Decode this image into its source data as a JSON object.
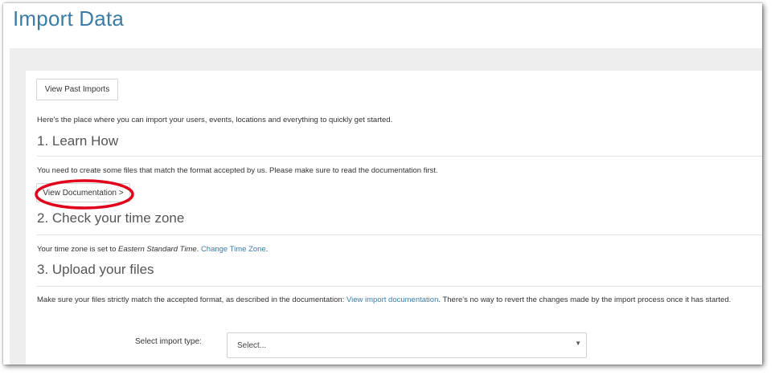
{
  "page": {
    "title": "Import Data"
  },
  "toolbar": {
    "past_imports_label": "View Past Imports"
  },
  "intro": {
    "text": "Here's the place where you can import your users, events, locations and everything to quickly get started."
  },
  "step1": {
    "heading": "1. Learn How",
    "text": "You need to create some files that match the format accepted by us. Please make sure to read the documentation first.",
    "doc_button_label": "View Documentation >"
  },
  "step2": {
    "heading": "2. Check your time zone",
    "text_prefix": "Your time zone is set to ",
    "time_zone": "Eastern Standard Time",
    "text_mid": ". ",
    "change_link": "Change Time Zone",
    "text_suffix": "."
  },
  "step3": {
    "heading": "3. Upload your files",
    "text_prefix": "Make sure your files strictly match the accepted format, as described in the documentation: ",
    "doc_link": "View import documentation",
    "text_suffix": ". There's no way to revert the changes made by the import process once it has started.",
    "select_label": "Select import type:",
    "select_value": "Select..."
  },
  "colors": {
    "accent": "#3a7ca5",
    "annotation": "#e0001b",
    "background_gray": "#eeeeee"
  },
  "icons": {
    "select_arrow": "caret-down-icon"
  }
}
